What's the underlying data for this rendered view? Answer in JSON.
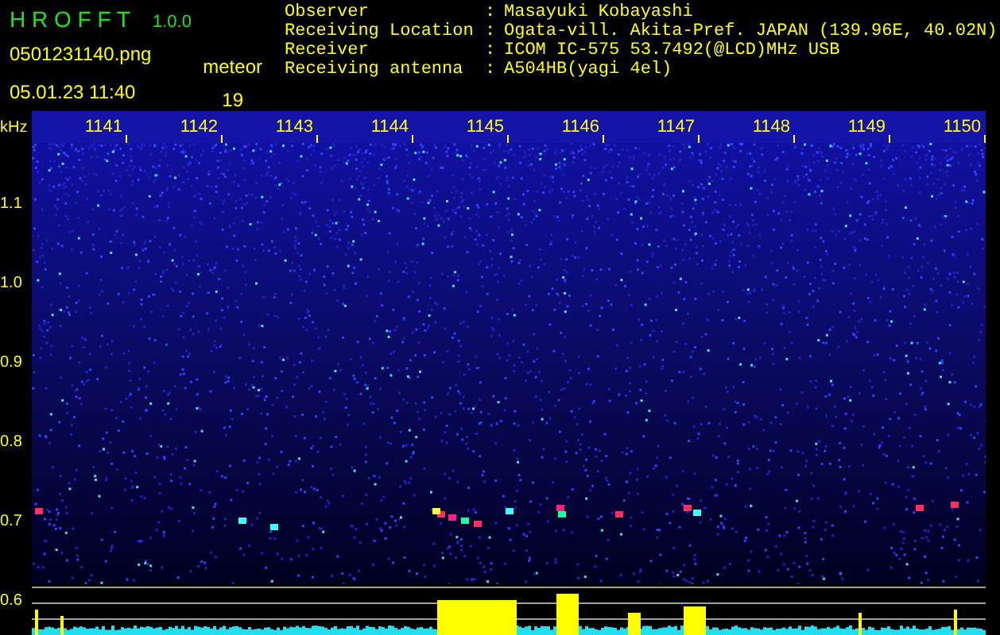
{
  "header": {
    "title": "H R O F F T",
    "version": "1.0.0",
    "file_name": "0501231140.png",
    "timestamp": "05.01.23 11:40",
    "detection_label": "meteor",
    "detection_count": "19"
  },
  "info": [
    {
      "label": "Observer",
      "separator": ":",
      "value": "Masayuki Kobayashi"
    },
    {
      "label": "Receiving Location",
      "separator": ":",
      "value": "Ogata-vill. Akita-Pref. JAPAN (139.96E, 40.02N)"
    },
    {
      "label": "Receiver",
      "separator": ":",
      "value": "ICOM IC-575 53.7492(@LCD)MHz USB"
    },
    {
      "label": "Receiving antenna",
      "separator": ":",
      "value": "A504HB(yagi 4el)"
    }
  ],
  "spectrogram": {
    "unit": "kHz",
    "x_labels": [
      "1141",
      "1142",
      "1143",
      "1144",
      "1145",
      "1146",
      "1147",
      "1148",
      "1149",
      "1150"
    ],
    "y_labels": [
      "1.1",
      "1.0",
      "0.9",
      "0.8",
      "0.7",
      "0.6"
    ]
  }
}
